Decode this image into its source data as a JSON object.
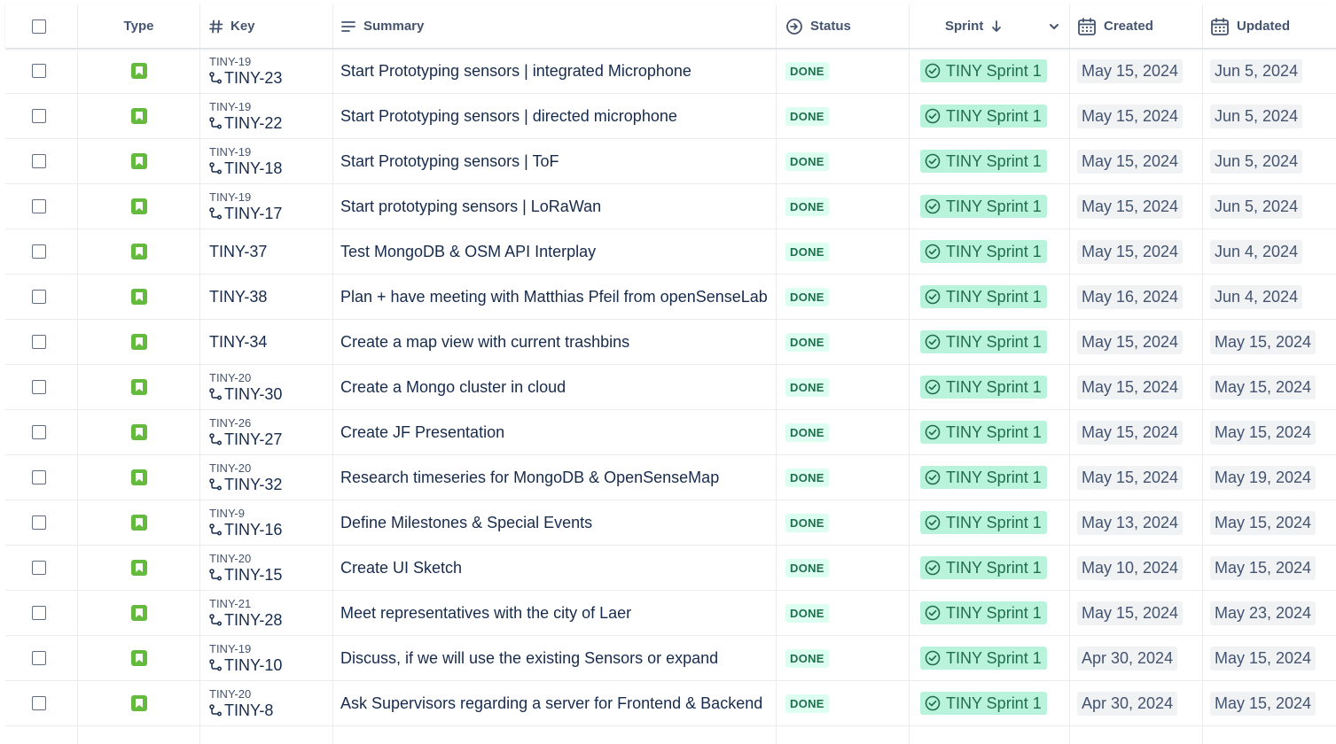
{
  "columns": {
    "type": "Type",
    "key": "Key",
    "summary": "Summary",
    "status": "Status",
    "sprint": "Sprint",
    "created": "Created",
    "updated": "Updated"
  },
  "icons": {
    "type_icon": "story-icon",
    "key_header": "hash-icon",
    "summary_header": "lines-icon",
    "status_header": "circle-arrow-icon",
    "sprint_sort": "arrow-down-icon",
    "sprint_menu": "chevron-down-icon",
    "date_header": "calendar-icon",
    "subtask": "subtask-icon",
    "sprint_done": "check-circle-icon"
  },
  "colors": {
    "type_icon_bg": "#63ba3c",
    "status_bg": "#dcfff1",
    "status_text": "#216e4e",
    "sprint_bg": "#baf3db",
    "date_bg": "#f1f2f4"
  },
  "rows": [
    {
      "parent": "TINY-19",
      "key": "TINY-23",
      "summary": "Start Prototyping sensors | integrated Microphone",
      "status": "DONE",
      "sprint": "TINY Sprint 1",
      "created": "May 15, 2024",
      "updated": "Jun 5, 2024"
    },
    {
      "parent": "TINY-19",
      "key": "TINY-22",
      "summary": "Start Prototyping sensors | directed microphone",
      "status": "DONE",
      "sprint": "TINY Sprint 1",
      "created": "May 15, 2024",
      "updated": "Jun 5, 2024"
    },
    {
      "parent": "TINY-19",
      "key": "TINY-18",
      "summary": "Start Prototyping sensors | ToF",
      "status": "DONE",
      "sprint": "TINY Sprint 1",
      "created": "May 15, 2024",
      "updated": "Jun 5, 2024"
    },
    {
      "parent": "TINY-19",
      "key": "TINY-17",
      "summary": "Start prototyping sensors | LoRaWan",
      "status": "DONE",
      "sprint": "TINY Sprint 1",
      "created": "May 15, 2024",
      "updated": "Jun 5, 2024"
    },
    {
      "parent": "",
      "key": "TINY-37",
      "summary": "Test MongoDB & OSM API Interplay",
      "status": "DONE",
      "sprint": "TINY Sprint 1",
      "created": "May 15, 2024",
      "updated": "Jun 4, 2024"
    },
    {
      "parent": "",
      "key": "TINY-38",
      "summary": "Plan + have meeting with Matthias Pfeil from openSenseLab",
      "status": "DONE",
      "sprint": "TINY Sprint 1",
      "created": "May 16, 2024",
      "updated": "Jun 4, 2024"
    },
    {
      "parent": "",
      "key": "TINY-34",
      "summary": "Create a map view with current trashbins",
      "status": "DONE",
      "sprint": "TINY Sprint 1",
      "created": "May 15, 2024",
      "updated": "May 15, 2024"
    },
    {
      "parent": "TINY-20",
      "key": "TINY-30",
      "summary": "Create a Mongo cluster in cloud",
      "status": "DONE",
      "sprint": "TINY Sprint 1",
      "created": "May 15, 2024",
      "updated": "May 15, 2024"
    },
    {
      "parent": "TINY-26",
      "key": "TINY-27",
      "summary": "Create JF Presentation",
      "status": "DONE",
      "sprint": "TINY Sprint 1",
      "created": "May 15, 2024",
      "updated": "May 15, 2024"
    },
    {
      "parent": "TINY-20",
      "key": "TINY-32",
      "summary": "Research timeseries for MongoDB & OpenSenseMap",
      "status": "DONE",
      "sprint": "TINY Sprint 1",
      "created": "May 15, 2024",
      "updated": "May 19, 2024"
    },
    {
      "parent": "TINY-9",
      "key": "TINY-16",
      "summary": "Define Milestones & Special Events",
      "status": "DONE",
      "sprint": "TINY Sprint 1",
      "created": "May 13, 2024",
      "updated": "May 15, 2024"
    },
    {
      "parent": "TINY-20",
      "key": "TINY-15",
      "summary": "Create UI Sketch",
      "status": "DONE",
      "sprint": "TINY Sprint 1",
      "created": "May 10, 2024",
      "updated": "May 15, 2024"
    },
    {
      "parent": "TINY-21",
      "key": "TINY-28",
      "summary": "Meet representatives with the city of Laer",
      "status": "DONE",
      "sprint": "TINY Sprint 1",
      "created": "May 15, 2024",
      "updated": "May 23, 2024"
    },
    {
      "parent": "TINY-19",
      "key": "TINY-10",
      "summary": "Discuss, if we will use the existing Sensors or expand",
      "status": "DONE",
      "sprint": "TINY Sprint 1",
      "created": "Apr 30, 2024",
      "updated": "May 15, 2024"
    },
    {
      "parent": "TINY-20",
      "key": "TINY-8",
      "summary": "Ask Supervisors regarding a server for Frontend & Backend",
      "status": "DONE",
      "sprint": "TINY Sprint 1",
      "created": "Apr 30, 2024",
      "updated": "May 15, 2024"
    }
  ]
}
